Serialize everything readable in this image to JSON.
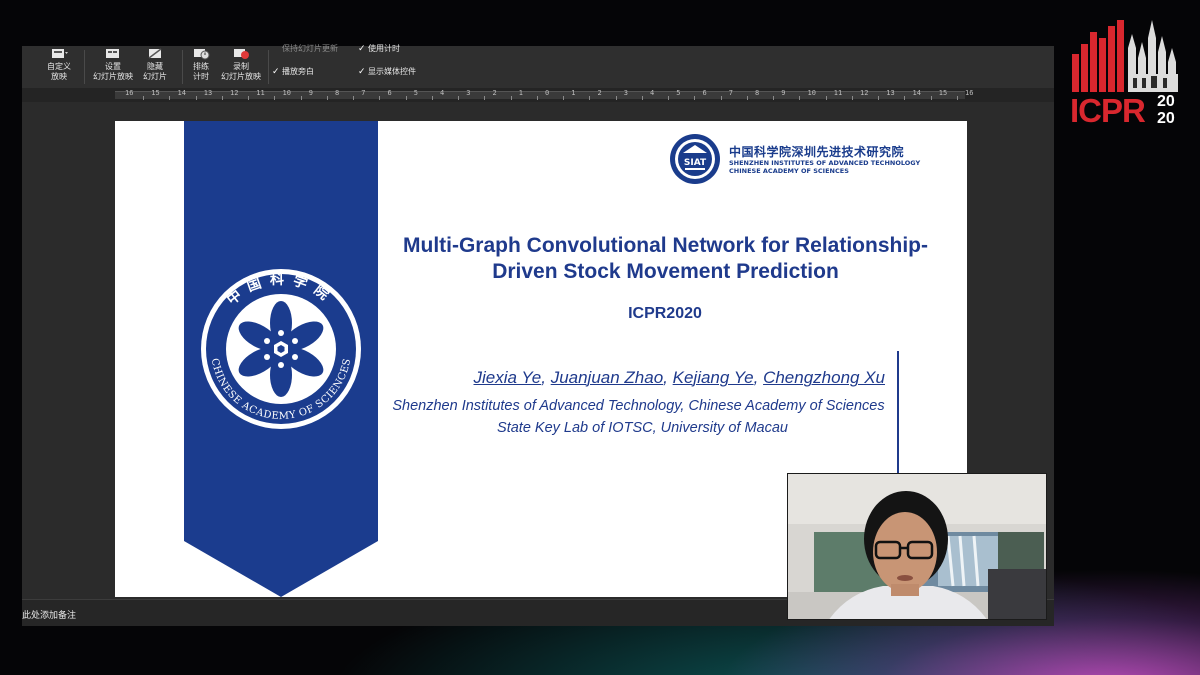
{
  "ribbon": {
    "buttons": [
      {
        "label": "自定义\n放映"
      },
      {
        "label": "设置\n幻灯片放映"
      },
      {
        "label": "隐藏\n幻灯片"
      },
      {
        "label": "排练\n计时"
      },
      {
        "label": "录制\n幻灯片放映"
      }
    ],
    "checkboxes": [
      {
        "label": "保持幻灯片更新",
        "checked": false
      },
      {
        "label": "使用计时",
        "checked": true
      },
      {
        "label": "播放旁白",
        "checked": true
      },
      {
        "label": "显示媒体控件",
        "checked": true
      }
    ]
  },
  "ruler": {
    "marks": [
      "16",
      "15",
      "14",
      "13",
      "12",
      "11",
      "10",
      "9",
      "8",
      "7",
      "6",
      "5",
      "4",
      "3",
      "2",
      "1",
      "0",
      "1",
      "2",
      "3",
      "4",
      "5",
      "6",
      "7",
      "8",
      "9",
      "10",
      "11",
      "12",
      "13",
      "14",
      "15",
      "16"
    ]
  },
  "slide": {
    "institute_logo_text": "SIAT",
    "institute_cn": "中国科学院深圳先进技术研究院",
    "institute_en_1": "SHENZHEN INSTITUTES OF ADVANCED TECHNOLOGY",
    "institute_en_2": "CHINESE ACADEMY OF SCIENCES",
    "title_line1": "Multi-Graph Convolutional Network for Relationship-",
    "title_line2": "Driven Stock Movement Prediction",
    "conference": "ICPR2020",
    "authors": [
      "Jiexia Ye",
      "Juanjuan Zhao",
      "Kejiang Ye",
      "Chengzhong Xu"
    ],
    "author_separator": ", ",
    "affiliation_1": "Shenzhen Institutes of Advanced Technology, Chinese Academy of Sciences",
    "affiliation_2": "State Key Lab of IOTSC, University of Macau",
    "emblem_cn": "中国科学院",
    "emblem_en": "CHINESE ACADEMY OF SCIENCES"
  },
  "notes_placeholder": "此处添加备注",
  "icpr_logo": {
    "text": "ICPR",
    "year_top": "20",
    "year_bottom": "20"
  },
  "colors": {
    "navy": "#1f3a8c",
    "banner": "#1b3c8e",
    "icpr_red": "#d9272e"
  }
}
